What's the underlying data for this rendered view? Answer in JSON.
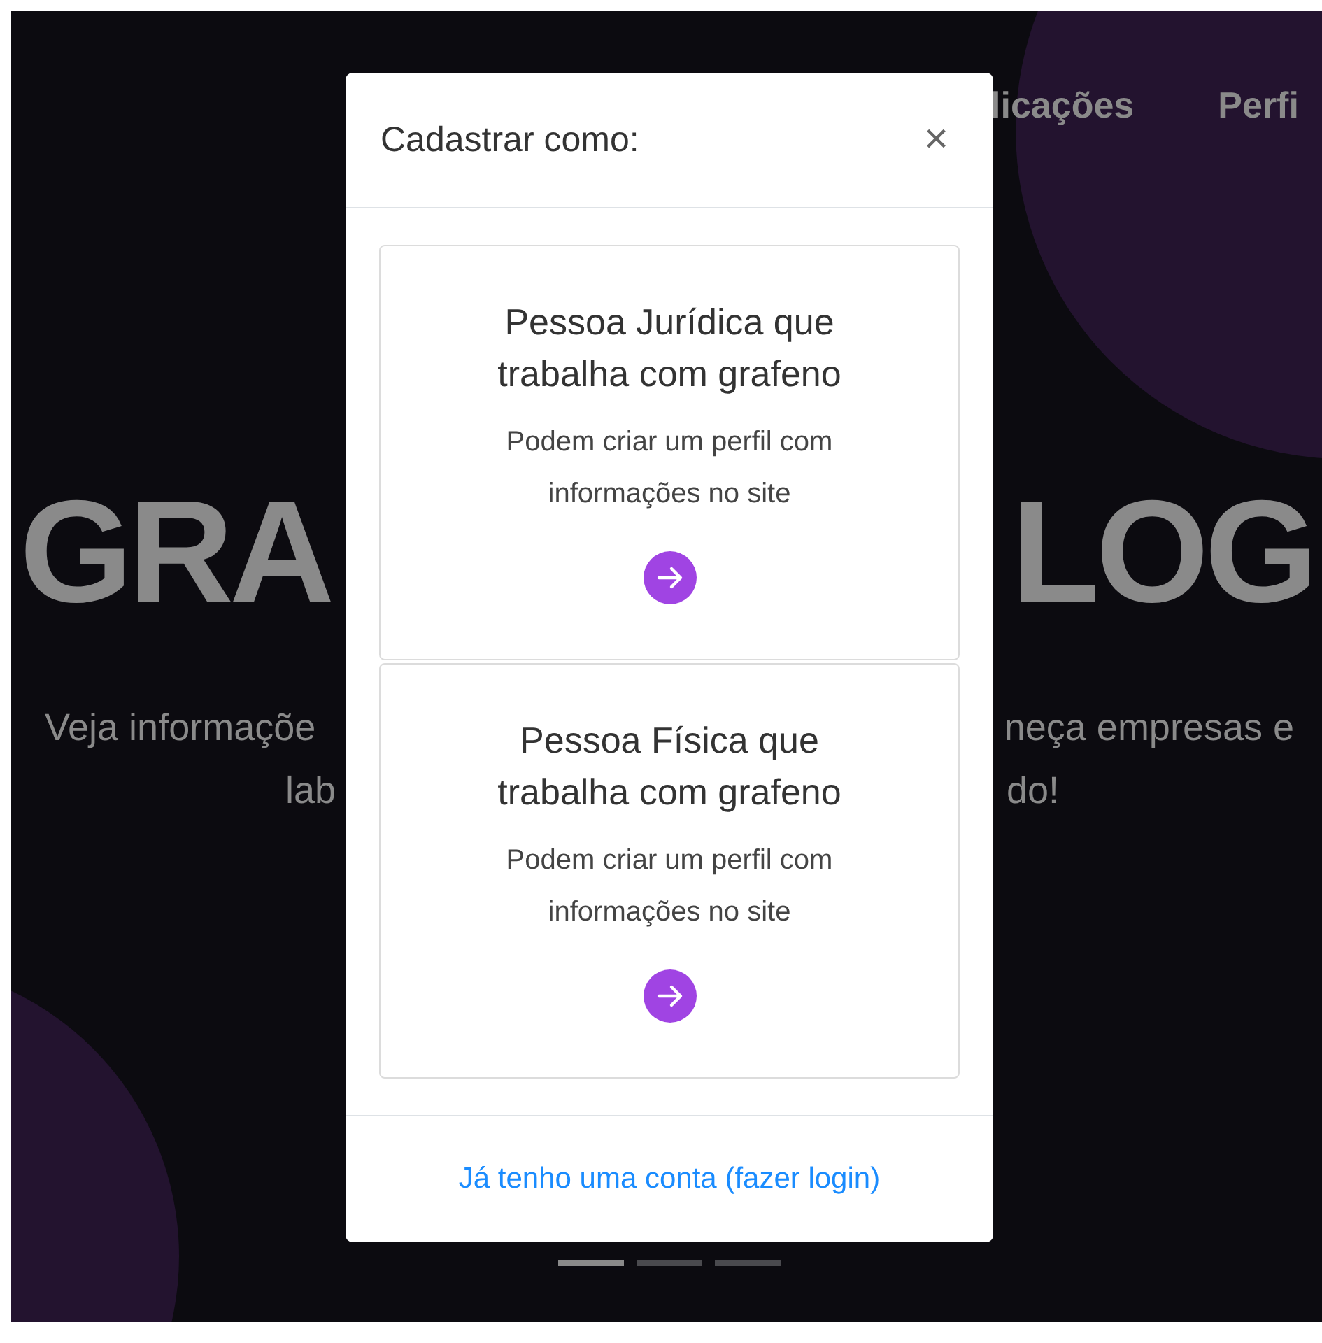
{
  "nav": [
    {
      "label": "licações"
    },
    {
      "label": "Perfi"
    }
  ],
  "hero": {
    "title_left": "GRA",
    "title_right": "LOG",
    "subtitle_line1_left": "Veja informaçõe",
    "subtitle_line1_right": "neça empresas e",
    "subtitle_line2_left": "lab",
    "subtitle_line2_right": "do!"
  },
  "modal": {
    "title": "Cadastrar como:",
    "close": "×",
    "options": [
      {
        "title": "Pessoa Jurídica que trabalha com grafeno",
        "description": "Podem criar um perfil com informações no site"
      },
      {
        "title": "Pessoa Física que trabalha com grafeno",
        "description": "Podem criar um perfil com informações no site"
      }
    ],
    "footer_link": "Já tenho uma conta (fazer login)"
  },
  "carousel_indicators": [
    {
      "selected": true
    },
    {
      "selected": false
    },
    {
      "selected": false
    }
  ]
}
